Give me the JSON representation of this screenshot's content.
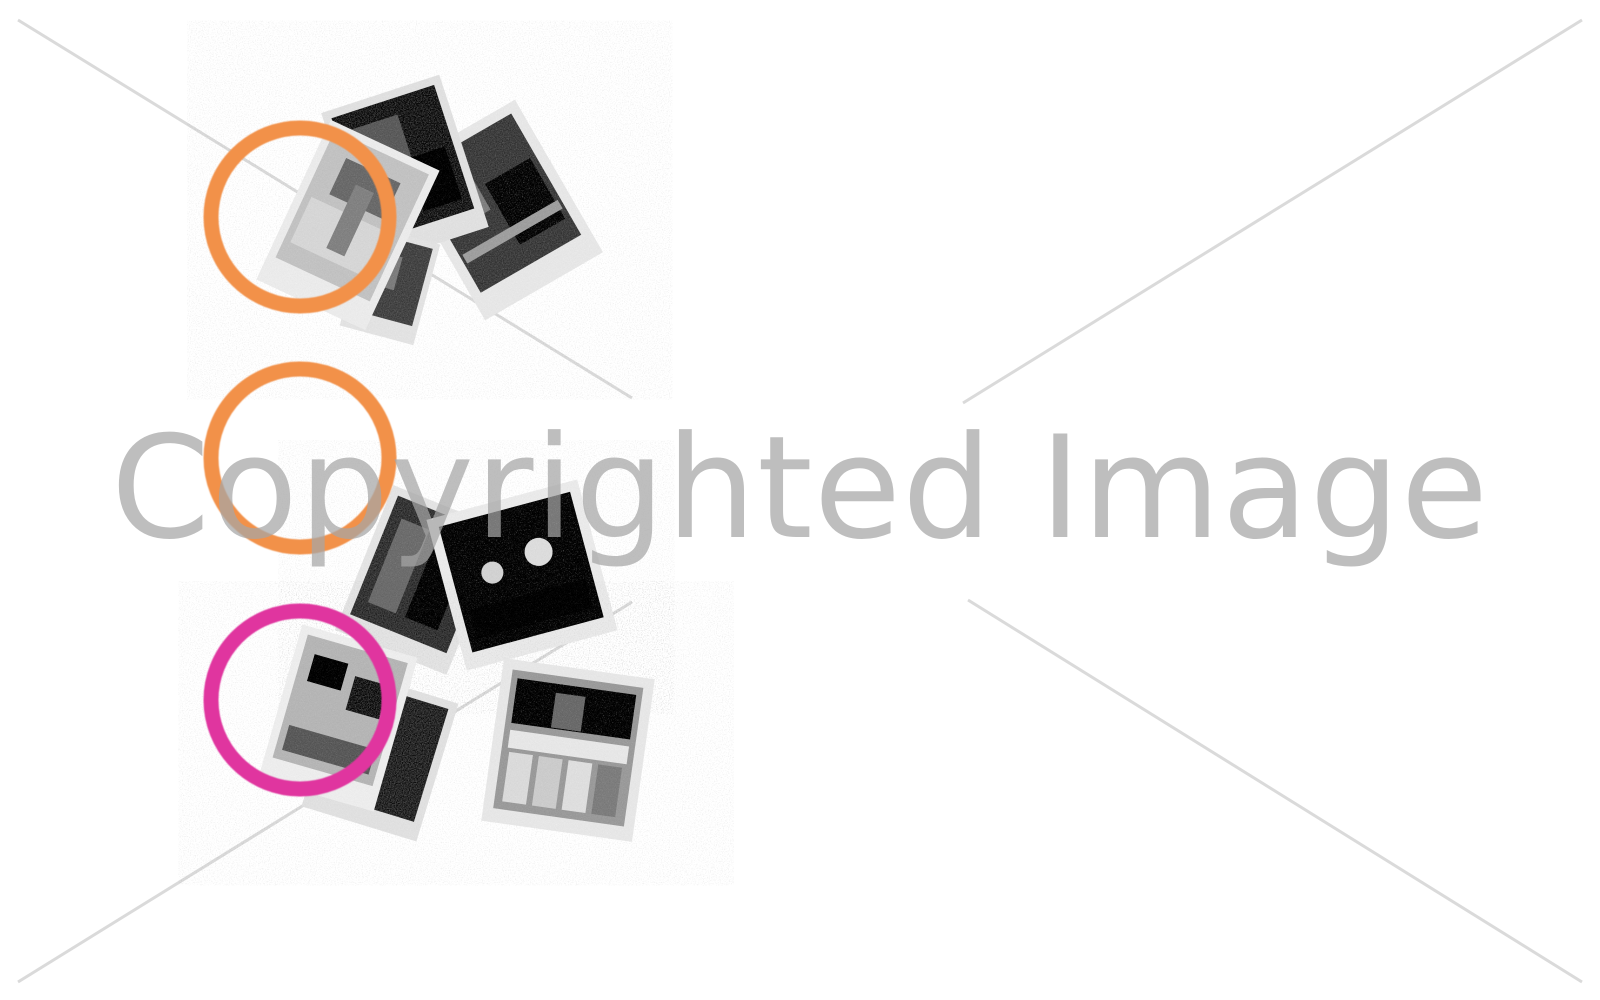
{
  "artwork": {
    "subject": "scattered-black-and-white-photo-prints",
    "accent_colors": {
      "ring_top": "#f2914a",
      "ring_middle": "#f2914a",
      "ring_bottom": "#e0359f"
    },
    "photo_tone": "#6f6f6f",
    "photo_border": "#ececec"
  },
  "watermark": {
    "text": "Copyrighted Image",
    "color": "#a6a6a6"
  }
}
